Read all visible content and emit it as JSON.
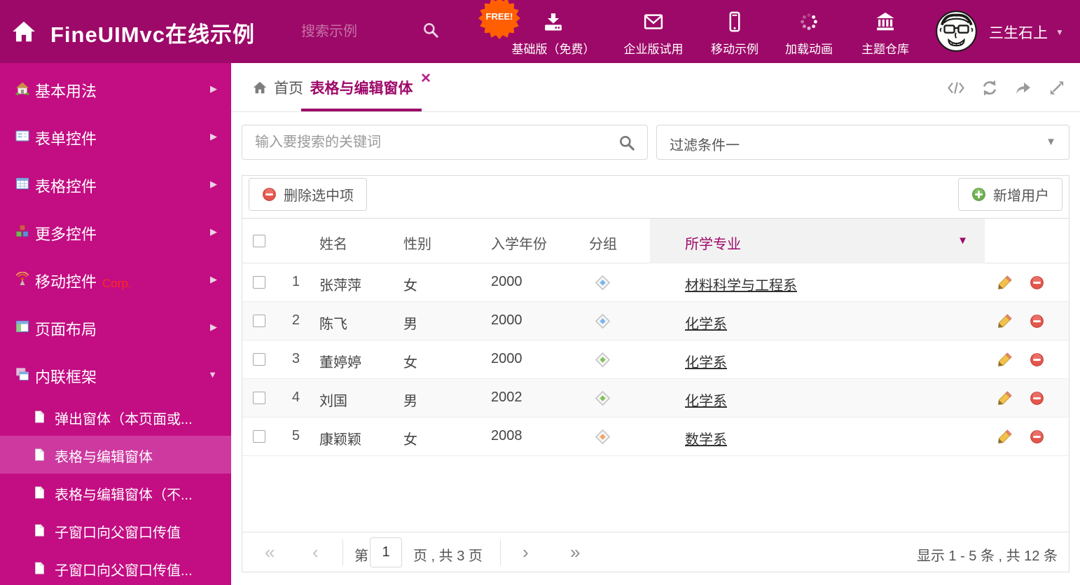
{
  "colors": {
    "header_bg": "#9d0968",
    "sidebar_bg": "#c30d82",
    "sidebar_selected_bg": "#ce39a0",
    "accent": "#9d0968",
    "free_badge": "#ff5f00",
    "delete_red": "#e4564c",
    "add_green": "#6db04f"
  },
  "header": {
    "title": "FineUIMvc在线示例",
    "search_placeholder": "搜索示例",
    "free_badge": "FREE!",
    "nav": [
      {
        "icon": "download-icon",
        "label": "基础版（免费）"
      },
      {
        "icon": "envelope-icon",
        "label": "企业版试用"
      },
      {
        "icon": "mobile-icon",
        "label": "移动示例"
      },
      {
        "icon": "spinner-icon",
        "label": "加载动画"
      },
      {
        "icon": "bank-icon",
        "label": "主题仓库"
      }
    ],
    "username": "三生石上"
  },
  "sidebar": {
    "items": [
      {
        "icon": "house-icon",
        "label": "基本用法"
      },
      {
        "icon": "form-icon",
        "label": "表单控件"
      },
      {
        "icon": "table-icon",
        "label": "表格控件"
      },
      {
        "icon": "cubes-icon",
        "label": "更多控件"
      },
      {
        "icon": "antenna-icon",
        "label": "移动控件",
        "badge": "Corp."
      },
      {
        "icon": "layout-icon",
        "label": "页面布局"
      },
      {
        "icon": "cascade-windows-icon",
        "label": "内联框架",
        "expanded": true
      }
    ],
    "children": [
      {
        "label": "弹出窗体（本页面或..."
      },
      {
        "label": "表格与编辑窗体",
        "selected": true
      },
      {
        "label": "表格与编辑窗体（不..."
      },
      {
        "label": "子窗口向父窗口传值"
      },
      {
        "label": "子窗口向父窗口传值..."
      }
    ]
  },
  "tabs": [
    {
      "label": "首页"
    },
    {
      "label": "表格与编辑窗体",
      "active": true,
      "closable": true
    }
  ],
  "filter": {
    "search_placeholder": "输入要搜索的关键词",
    "dropdown_value": "过滤条件一"
  },
  "grid": {
    "delete_button": "删除选中项",
    "add_button": "新增用户",
    "columns": {
      "name": "姓名",
      "gender": "性别",
      "year": "入学年份",
      "group": "分组",
      "major": "所学专业"
    },
    "rows": [
      {
        "num": "1",
        "name": "张萍萍",
        "gender": "女",
        "year": "2000",
        "tag_color": "#76b6f2",
        "major": "材料科学与工程系"
      },
      {
        "num": "2",
        "name": "陈飞",
        "gender": "男",
        "year": "2000",
        "tag_color": "#76b6f2",
        "major": "化学系"
      },
      {
        "num": "3",
        "name": "董婷婷",
        "gender": "女",
        "year": "2000",
        "tag_color": "#83c155",
        "major": "化学系"
      },
      {
        "num": "4",
        "name": "刘国",
        "gender": "男",
        "year": "2002",
        "tag_color": "#83c155",
        "major": "化学系"
      },
      {
        "num": "5",
        "name": "康颖颖",
        "gender": "女",
        "year": "2008",
        "tag_color": "#f6a35c",
        "major": "数学系"
      }
    ],
    "pagination": {
      "page_prefix": "第",
      "page_value": "1",
      "page_suffix": "页 , 共 3 页",
      "summary": "显示 1 - 5 条 , 共 12 条"
    }
  }
}
